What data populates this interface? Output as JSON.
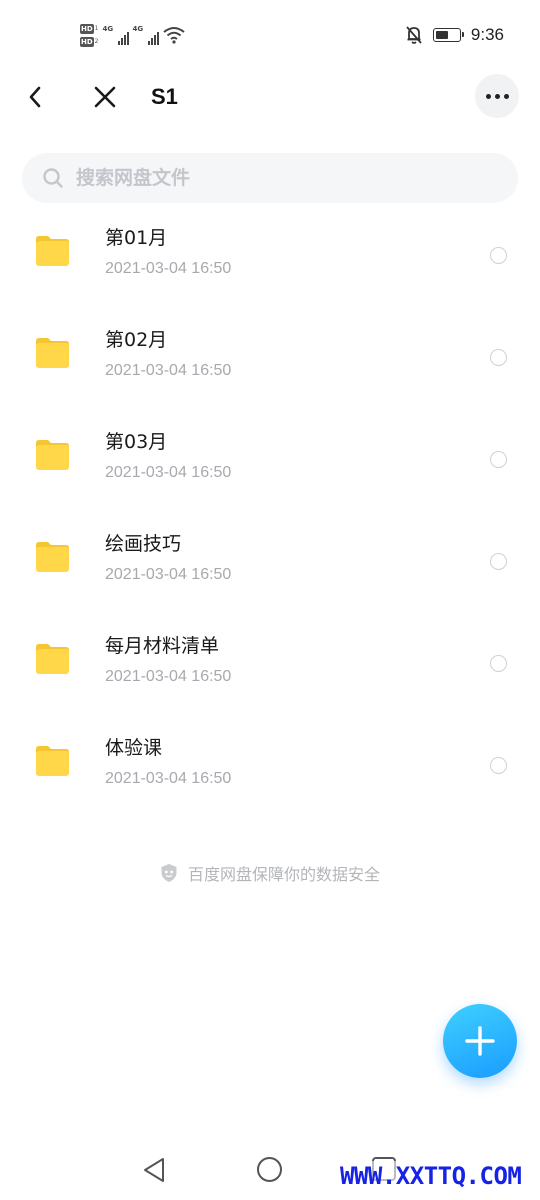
{
  "status_bar": {
    "hd1": "HD",
    "hd1_sub": "1",
    "hd2": "HD",
    "hd2_sub": "2",
    "net1": "4G",
    "net2": "4G",
    "time": "9:36",
    "battery_level": 0.55,
    "icons": [
      "hd-icon",
      "signal-icon",
      "wifi-icon",
      "bell-off-icon",
      "battery-icon"
    ]
  },
  "header": {
    "title": "S1",
    "icons": [
      "chevron-left-icon",
      "close-icon",
      "more-icon"
    ]
  },
  "search": {
    "placeholder": "搜索网盘文件",
    "value": ""
  },
  "files": [
    {
      "name": "第01月",
      "date": "2021-03-04  16:50"
    },
    {
      "name": "第02月",
      "date": "2021-03-04  16:50"
    },
    {
      "name": "第03月",
      "date": "2021-03-04  16:50"
    },
    {
      "name": "绘画技巧",
      "date": "2021-03-04  16:50"
    },
    {
      "name": "每月材料清单",
      "date": "2021-03-04  16:50"
    },
    {
      "name": "体验课",
      "date": "2021-03-04  16:50"
    }
  ],
  "footer": {
    "safety_text": "百度网盘保障你的数据安全"
  },
  "colors": {
    "folder": "#ffd748",
    "folder_tab": "#f6c632",
    "fab_start": "#3fd0ff",
    "fab_end": "#1a9cff",
    "watermark": "#1622e6"
  },
  "watermark": "WWW.XXTTQ.COM"
}
